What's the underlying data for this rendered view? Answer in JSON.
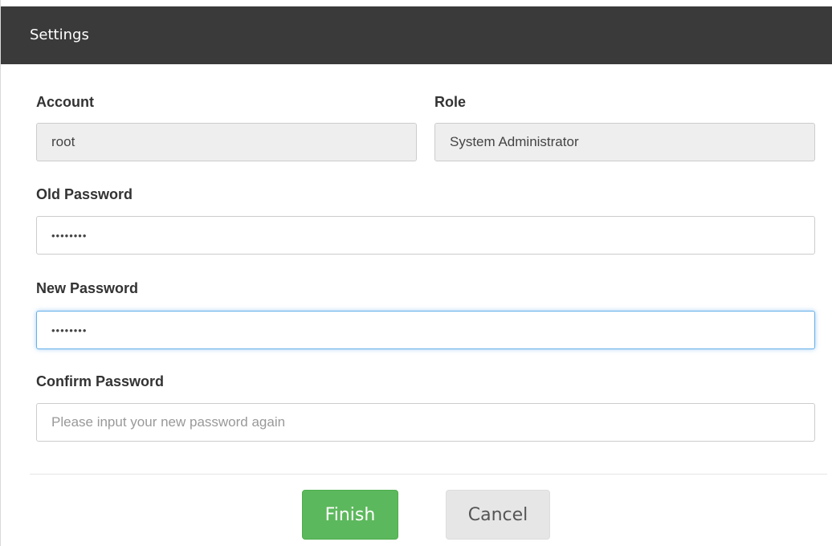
{
  "dialog": {
    "title": "Settings"
  },
  "form": {
    "account": {
      "label": "Account",
      "value": "root"
    },
    "role": {
      "label": "Role",
      "value": "System Administrator"
    },
    "old_password": {
      "label": "Old Password",
      "value": "••••••••"
    },
    "new_password": {
      "label": "New Password",
      "value": "••••••••"
    },
    "confirm_password": {
      "label": "Confirm Password",
      "value": "",
      "placeholder": "Please input your new password again"
    }
  },
  "actions": {
    "finish_label": "Finish",
    "cancel_label": "Cancel"
  },
  "colors": {
    "titlebar": "#3a3a3a",
    "primary_button": "#5cb85c",
    "focus_ring": "#66afe9"
  }
}
